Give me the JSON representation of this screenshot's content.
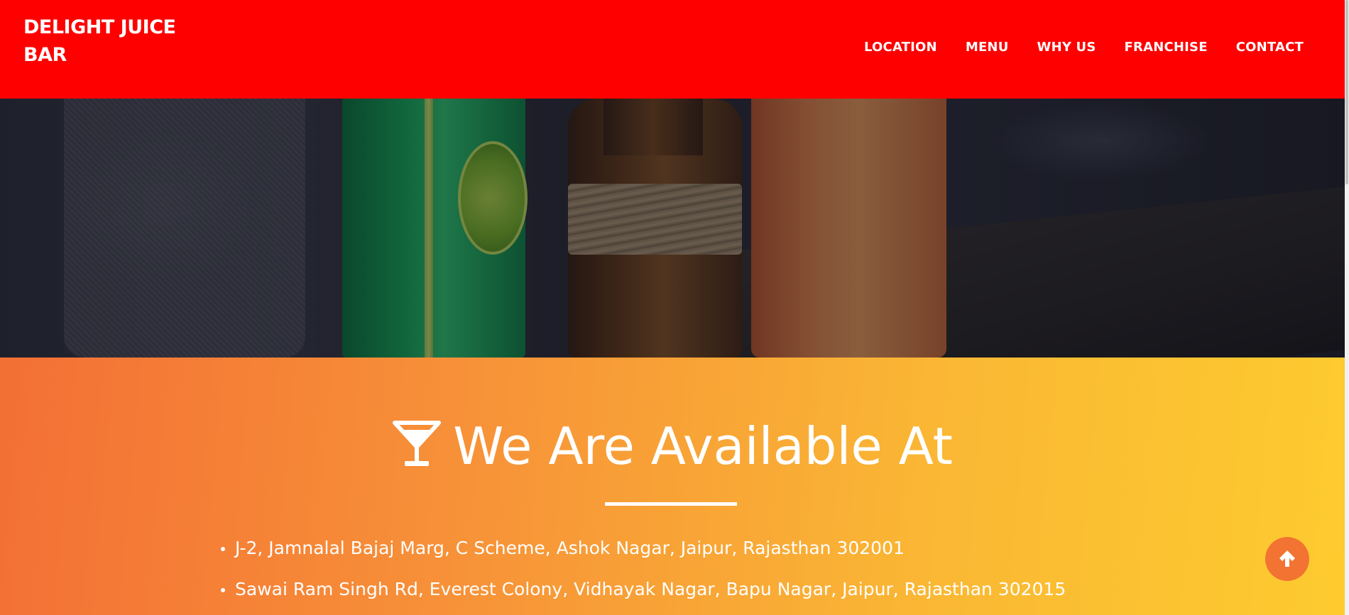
{
  "navbar": {
    "brand": "DELIGHT JUICE BAR",
    "links": [
      {
        "label": "LOCATION"
      },
      {
        "label": "MENU"
      },
      {
        "label": "WHY US"
      },
      {
        "label": "FRANCHISE"
      },
      {
        "label": "CONTACT"
      }
    ],
    "background_color": "#ff0000"
  },
  "hero": {
    "image_description_icon": "drinks-photo"
  },
  "locations": {
    "heading_icon": "cocktail-glass-icon",
    "heading": "We Are Available At",
    "addresses": [
      "J-2, Jamnalal Bajaj Marg, C Scheme, Ashok Nagar, Jaipur, Rajasthan 302001",
      "Sawai Ram Singh Rd, Everest Colony, Vidhayak Nagar, Bapu Nagar, Jaipur, Rajasthan 302015"
    ],
    "gradient_start": "#f36f35",
    "gradient_end": "#fdcb2f"
  },
  "back_to_top": {
    "icon": "arrow-up-icon",
    "color": "#f37332"
  }
}
